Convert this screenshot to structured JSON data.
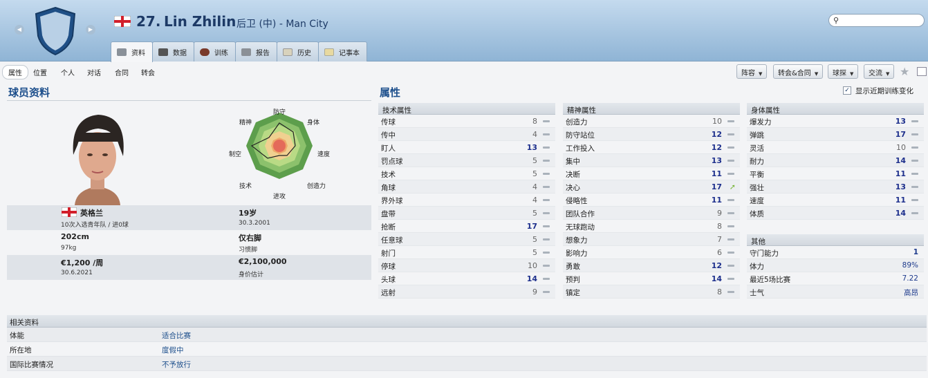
{
  "header": {
    "number": "27.",
    "name": "Lin Zhilin",
    "position_club": "后卫 (中) - Man City"
  },
  "tabs": [
    "资料",
    "数据",
    "训练",
    "报告",
    "历史",
    "记事本"
  ],
  "subnav": [
    "属性",
    "位置",
    "个人",
    "对话",
    "合同",
    "转会"
  ],
  "toolbar": [
    "阵容",
    "转会&合同",
    "球探",
    "交流"
  ],
  "left": {
    "title": "球员资料",
    "radar_labels": {
      "top": "防守",
      "tr": "身体",
      "r": "速度",
      "br": "创造力",
      "b": "进攻",
      "bl": "技术",
      "l": "制空",
      "tl": "精神"
    },
    "bio": {
      "nation": "英格兰",
      "caps": "10次入选青年队 / 进0球",
      "age": "19岁",
      "dob": "30.3.2001",
      "height": "202cm",
      "weight": "97kg",
      "foot": "仅右脚",
      "foot_label": "习惯脚",
      "wage": "€1,200 /周",
      "contract": "30.6.2021",
      "value": "€2,100,000",
      "value_label": "身价估计"
    }
  },
  "attributes": {
    "title": "属性",
    "recent_label": "显示近期训练变化",
    "technical": {
      "title": "技术属性",
      "items": [
        [
          "传球",
          "8"
        ],
        [
          "传中",
          "4"
        ],
        [
          "盯人",
          "13"
        ],
        [
          "罚点球",
          "5"
        ],
        [
          "技术",
          "5"
        ],
        [
          "角球",
          "4"
        ],
        [
          "界外球",
          "4"
        ],
        [
          "盘带",
          "5"
        ],
        [
          "抢断",
          "17"
        ],
        [
          "任意球",
          "5"
        ],
        [
          "射门",
          "5"
        ],
        [
          "停球",
          "10"
        ],
        [
          "头球",
          "14"
        ],
        [
          "远射",
          "9"
        ]
      ]
    },
    "mental": {
      "title": "精神属性",
      "items": [
        [
          "创造力",
          "10"
        ],
        [
          "防守站位",
          "12"
        ],
        [
          "工作投入",
          "12"
        ],
        [
          "集中",
          "13"
        ],
        [
          "决断",
          "11"
        ],
        [
          "决心",
          "17"
        ],
        [
          "侵略性",
          "11"
        ],
        [
          "团队合作",
          "9"
        ],
        [
          "无球跑动",
          "8"
        ],
        [
          "想象力",
          "7"
        ],
        [
          "影响力",
          "6"
        ],
        [
          "勇敢",
          "12"
        ],
        [
          "预判",
          "14"
        ],
        [
          "镇定",
          "8"
        ]
      ]
    },
    "physical": {
      "title": "身体属性",
      "items": [
        [
          "爆发力",
          "13"
        ],
        [
          "弹跳",
          "17"
        ],
        [
          "灵活",
          "10"
        ],
        [
          "耐力",
          "14"
        ],
        [
          "平衡",
          "11"
        ],
        [
          "强壮",
          "13"
        ],
        [
          "速度",
          "11"
        ],
        [
          "体质",
          "14"
        ]
      ]
    },
    "other": {
      "title": "其他",
      "items": [
        [
          "守门能力",
          "1"
        ],
        [
          "体力",
          "89%"
        ],
        [
          "最近5场比赛",
          "7.22"
        ],
        [
          "士气",
          "高昂"
        ]
      ]
    }
  },
  "related": {
    "title": "相关资料",
    "rows": [
      [
        "体能",
        "适合比赛"
      ],
      [
        "所在地",
        "度假中"
      ],
      [
        "国际比赛情况",
        "不予放行"
      ]
    ]
  }
}
